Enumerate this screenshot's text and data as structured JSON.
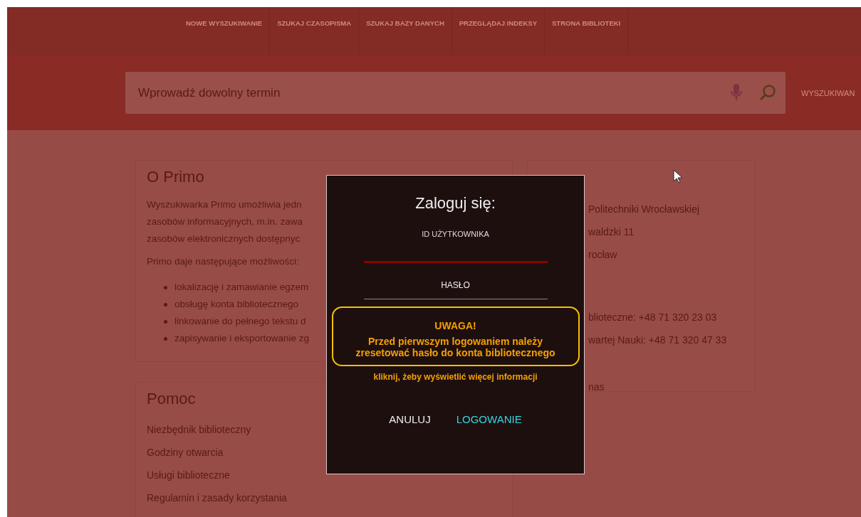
{
  "nav": {
    "items": [
      "NOWE WYSZUKIWANIE",
      "SZUKAJ CZASOPISMA",
      "SZUKAJ BAZY DANYCH",
      "PRZEGLĄDAJ INDEKSY",
      "STRONA BIBLIOTEKI"
    ]
  },
  "search": {
    "placeholder": "Wprowadź dowolny termin",
    "advanced": "WYSZUKIWAN"
  },
  "about": {
    "title": "O Primo",
    "intro_lines": [
      "Wyszukiwarka Primo umożliwia jedn",
      "zasobów informacyjnych, m.in. zawa",
      "zasobów elektronicznych dostępnyc"
    ],
    "lead": "Primo daje następujące możliwości:",
    "bullets": [
      "lokalizację i zamawianie egzem",
      "obsługę konta bibliotecznego",
      "linkowanie do pełnego tekstu d",
      "zapisywanie i eksportowanie zg"
    ]
  },
  "contact": {
    "lines": [
      "Politechniki Wrocławskiej",
      "waldzki 11",
      "rocław"
    ],
    "phones": [
      "blioteczne: +48 71 320 23 03",
      "wartej Nauki: +48 71 320 47 33"
    ],
    "link": "nas"
  },
  "help": {
    "title": "Pomoc",
    "links": [
      "Niezbędnik biblioteczny",
      "Godziny otwarcia",
      "Usługi biblioteczne",
      "Regulamin i zasady korzystania"
    ]
  },
  "dialog": {
    "title": "Zaloguj się:",
    "fields": [
      {
        "label": "ID UŻYTKOWNIKA",
        "focused": true
      },
      {
        "label": "HASŁO",
        "focused": false
      }
    ],
    "notice": {
      "heading": "UWAGA!",
      "text": "Przed pierwszym logowaniem należy zresetować hasło do konta bibliotecznego"
    },
    "more": "kliknij, żeby wyświetlić więcej informacji",
    "buttons": [
      {
        "label": "ANULUJ",
        "kind": "cancel"
      },
      {
        "label": "LOGOWANIE",
        "kind": "primary"
      }
    ]
  }
}
